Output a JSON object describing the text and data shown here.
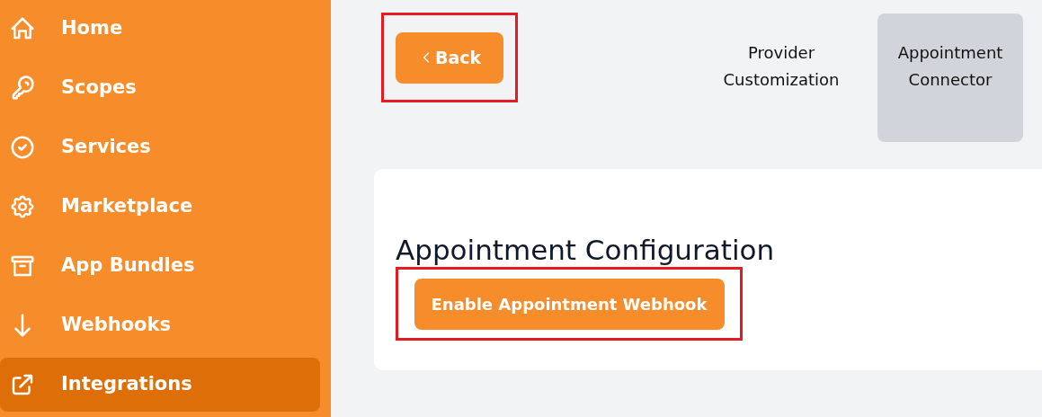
{
  "sidebar": {
    "items": [
      {
        "label": "Home",
        "selected": false
      },
      {
        "label": "Scopes",
        "selected": false
      },
      {
        "label": "Services",
        "selected": false
      },
      {
        "label": "Marketplace",
        "selected": false
      },
      {
        "label": "App Bundles",
        "selected": false
      },
      {
        "label": "Webhooks",
        "selected": false
      },
      {
        "label": "Integrations",
        "selected": true
      }
    ]
  },
  "back_button": {
    "label": "Back",
    "highlighted": true
  },
  "tabs": [
    {
      "label": "Provider Customization",
      "selected": false
    },
    {
      "label": "Appointment Connector",
      "selected": true
    }
  ],
  "card": {
    "title": "Appointment Configuration",
    "button": {
      "label": "Enable Appointment Webhook",
      "highlighted": true
    }
  }
}
